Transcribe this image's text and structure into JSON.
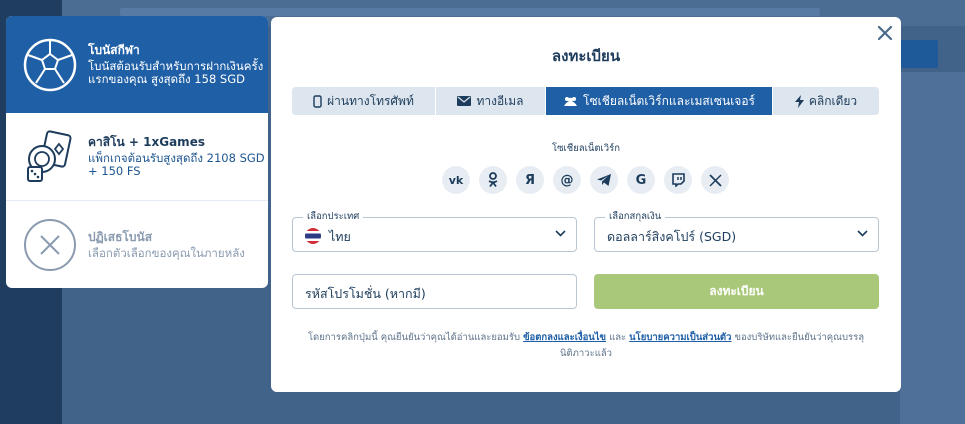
{
  "bonus_panel": {
    "sports": {
      "icon": "soccer-ball-icon",
      "title": "โบนัสกีฬา",
      "desc": "โบนัสต้อนรับสำหรับการฝากเงินครั้งแรกของคุณ สูงสุดถึง 158 SGD"
    },
    "casino": {
      "icon": "casino-chips-cards-icon",
      "title": "คาสิโน + 1xGames",
      "desc": "แพ็กเกจต้อนรับสูงสุดถึง 2108 SGD + 150 FS"
    },
    "decline": {
      "icon": "close-circle-icon",
      "title": "ปฏิเสธโบนัส",
      "desc": "เลือกตัวเลือกของคุณในภายหลัง"
    }
  },
  "modal": {
    "title": "ลงทะเบียน",
    "close_icon": "close-icon",
    "tabs": [
      {
        "label": "ผ่านทางโทรศัพท์",
        "icon": "phone-icon"
      },
      {
        "label": "ทางอีเมล",
        "icon": "envelope-icon"
      },
      {
        "label": "โซเชียลเน็ตเวิร์กและเมสเซนเจอร์",
        "icon": "users-icon"
      },
      {
        "label": "คลิกเดียว",
        "icon": "lightning-icon"
      }
    ],
    "social_label": "โซเชียลเน็ตเวิร์ก",
    "social": {
      "vk": "vk",
      "ok": "ok",
      "yandex": "Я",
      "mail": "@",
      "telegram": "telegram",
      "google": "G",
      "twitch": "twitch",
      "x": "X"
    },
    "country": {
      "legend": "เลือกประเทศ",
      "value": "ไทย"
    },
    "currency": {
      "legend": "เลือกสกุลเงิน",
      "value": "ดอลลาร์สิงคโปร์ (SGD)"
    },
    "promo": {
      "placeholder": "รหัสโปรโมชั่น (หากมี)"
    },
    "register_label": "ลงทะเบียน",
    "terms": {
      "pre": "โดยการคลิกปุ่มนี้ คุณยืนยันว่าคุณได้อ่านและยอมรับ ",
      "link1": "ข้อตกลงและเงื่อนไข",
      "mid": " และ ",
      "link2": "นโยบายความเป็นส่วนตัว",
      "post": " ของบริษัทและยืนยันว่าคุณบรรลุนิติภาวะแล้ว"
    }
  },
  "colors": {
    "primary": "#1f5fa6",
    "register_button": "#aac87a",
    "text_dark": "#1d3c5c",
    "overlay": "#41638a"
  }
}
